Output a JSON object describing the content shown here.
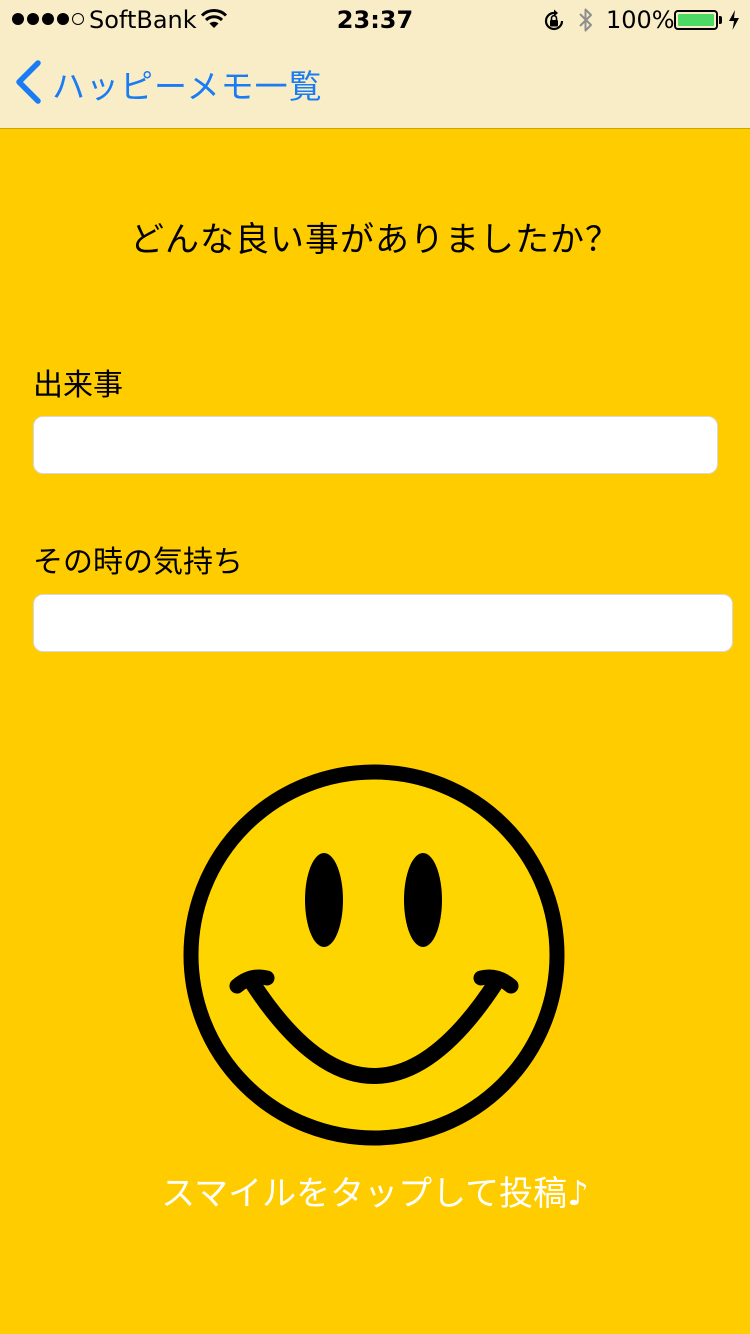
{
  "status_bar": {
    "carrier": "SoftBank",
    "time": "23:37",
    "battery_percent": "100%",
    "signal_bars_filled": 4,
    "signal_bars_total": 5
  },
  "nav": {
    "back_label": "ハッピーメモ一覧"
  },
  "form": {
    "question": "どんな良い事がありましたか？",
    "event_label": "出来事",
    "event_value": "",
    "feeling_label": "その時の気持ち",
    "feeling_value": ""
  },
  "submit": {
    "hint": "スマイルをタップして投稿♪",
    "icon": "smiley-face-icon"
  },
  "colors": {
    "background": "#FFCC00",
    "nav_background": "#F8EDC6",
    "accent": "#1A7CF5",
    "smiley_face": "#FFD500",
    "hint_text": "#FFFFFF"
  }
}
